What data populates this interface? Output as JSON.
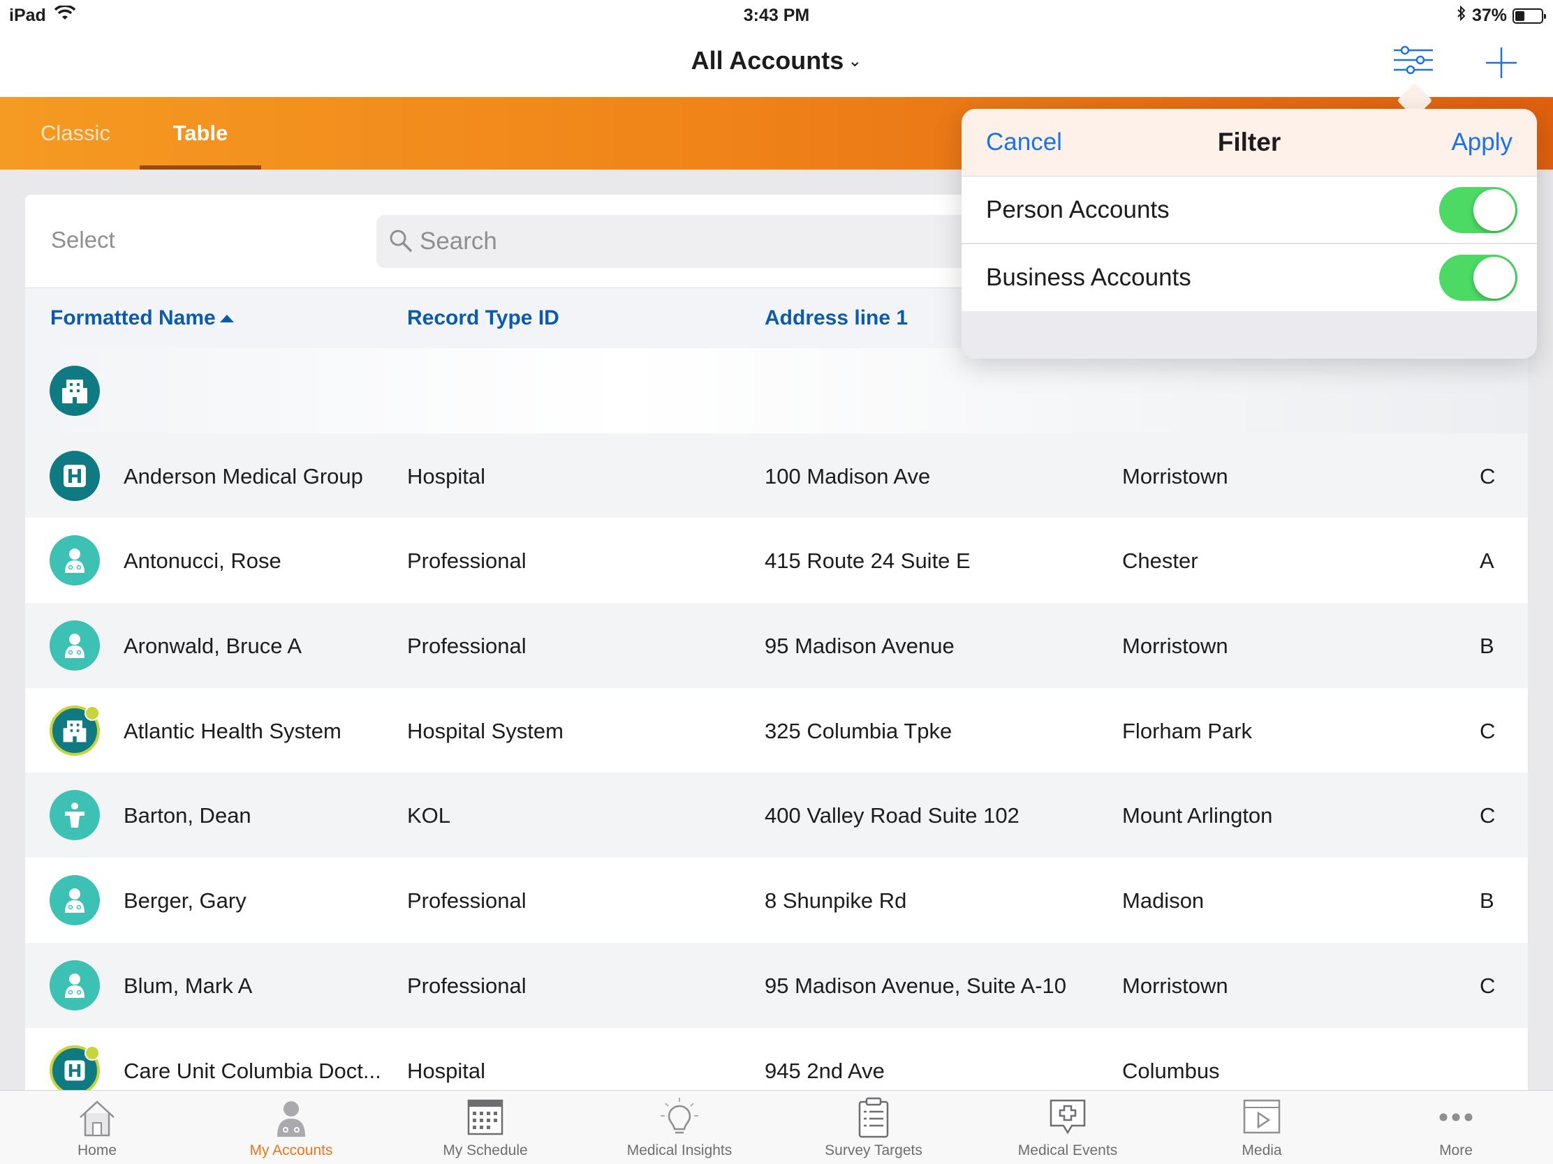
{
  "status_bar": {
    "device": "iPad",
    "time": "3:43 PM",
    "battery": "37%",
    "battery_level": 0.37
  },
  "nav": {
    "title": "All Accounts",
    "icons": [
      "filter-sliders-icon",
      "add-icon"
    ]
  },
  "tabs": [
    {
      "label": "Classic",
      "active": false
    },
    {
      "label": "Table",
      "active": true
    }
  ],
  "toolbar": {
    "select_label": "Select",
    "search_placeholder": "Search"
  },
  "table": {
    "columns": [
      "Formatted Name",
      "Record Type ID",
      "Address line 1"
    ],
    "sort_column": "Formatted Name",
    "sort_direction": "ascending",
    "rows": [
      {
        "icon": "building-icon",
        "name": "",
        "type": "",
        "address": "",
        "city": "",
        "tier": ""
      },
      {
        "icon": "hospital-icon",
        "name": "Anderson Medical Group",
        "type": "Hospital",
        "address": "100 Madison Ave",
        "city": "Morristown",
        "tier": "C"
      },
      {
        "icon": "doctor-icon",
        "name": "Antonucci, Rose",
        "type": "Professional",
        "address": "415 Route 24 Suite E",
        "city": "Chester",
        "tier": "A"
      },
      {
        "icon": "doctor-icon",
        "name": "Aronwald, Bruce A",
        "type": "Professional",
        "address": "95 Madison Avenue",
        "city": "Morristown",
        "tier": "B"
      },
      {
        "icon": "building-icon",
        "name": "Atlantic Health System",
        "type": "Hospital System",
        "address": "325 Columbia Tpke",
        "city": "Florham Park",
        "tier": "C"
      },
      {
        "icon": "kol-podium-icon",
        "name": "Barton, Dean",
        "type": "KOL",
        "address": "400 Valley Road Suite 102",
        "city": "Mount Arlington",
        "tier": "C"
      },
      {
        "icon": "doctor-icon",
        "name": "Berger, Gary",
        "type": "Professional",
        "address": "8 Shunpike Rd",
        "city": "Madison",
        "tier": "B"
      },
      {
        "icon": "doctor-icon",
        "name": "Blum, Mark A",
        "type": "Professional",
        "address": "95 Madison Avenue, Suite A-10",
        "city": "Morristown",
        "tier": "C"
      },
      {
        "icon": "hospital-icon",
        "name": "Care Unit Columbia Doct...",
        "type": "Hospital",
        "address": "945 2nd Ave",
        "city": "Columbus",
        "tier": ""
      }
    ]
  },
  "filter_popover": {
    "cancel_label": "Cancel",
    "title": "Filter",
    "apply_label": "Apply",
    "options": [
      {
        "label": "Person Accounts",
        "enabled": true
      },
      {
        "label": "Business Accounts",
        "enabled": true
      }
    ]
  },
  "bottom_tabs": [
    {
      "label": "Home",
      "icon": "home-icon",
      "active": false
    },
    {
      "label": "My Accounts",
      "icon": "accounts-icon",
      "active": true
    },
    {
      "label": "My Schedule",
      "icon": "calendar-icon",
      "active": false
    },
    {
      "label": "Medical Insights",
      "icon": "lightbulb-icon",
      "active": false
    },
    {
      "label": "Survey Targets",
      "icon": "clipboard-icon",
      "active": false
    },
    {
      "label": "Medical Events",
      "icon": "medical-event-icon",
      "active": false
    },
    {
      "label": "Media",
      "icon": "media-icon",
      "active": false
    },
    {
      "label": "More",
      "icon": "more-dots-icon",
      "active": false
    }
  ],
  "colors": {
    "accent_orange": "#f08419",
    "link_blue": "#1a73e8",
    "header_blue": "#0b5ba8",
    "toggle_green": "#4cd964",
    "org_teal": "#0f7a82",
    "person_teal": "#3ec1b5"
  }
}
